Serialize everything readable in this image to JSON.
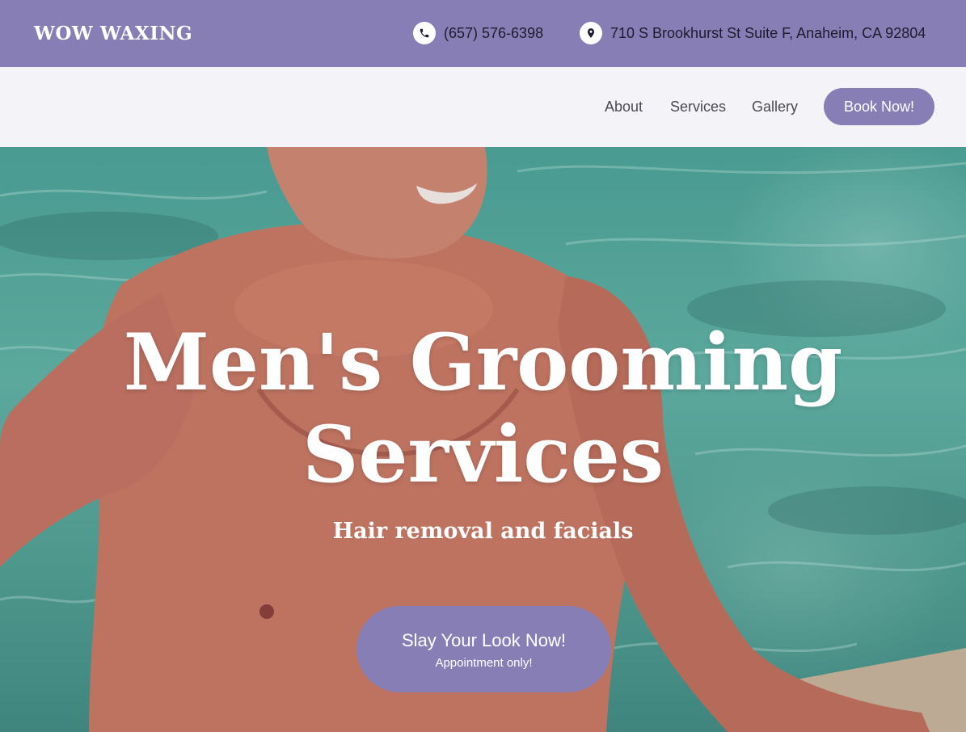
{
  "header": {
    "brand": "WOW WAXING",
    "phone": "(657) 576-6398",
    "address": "710 S Brookhurst St Suite F, Anaheim, CA 92804",
    "phone_icon": "phone-icon",
    "address_icon": "map-pin-icon"
  },
  "nav": {
    "items": [
      {
        "label": "About"
      },
      {
        "label": "Services"
      },
      {
        "label": "Gallery"
      }
    ],
    "book_label": "Book Now!"
  },
  "hero": {
    "title_line1": "Men's Grooming",
    "title_line2": "Services",
    "subtitle": "Hair removal and facials",
    "cta_label": "Slay Your Look Now!",
    "cta_note": "Appointment only!"
  },
  "colors": {
    "brand_purple": "#877eb5",
    "nav_bg": "#f4f3f8",
    "water_teal": "#4aa596"
  }
}
